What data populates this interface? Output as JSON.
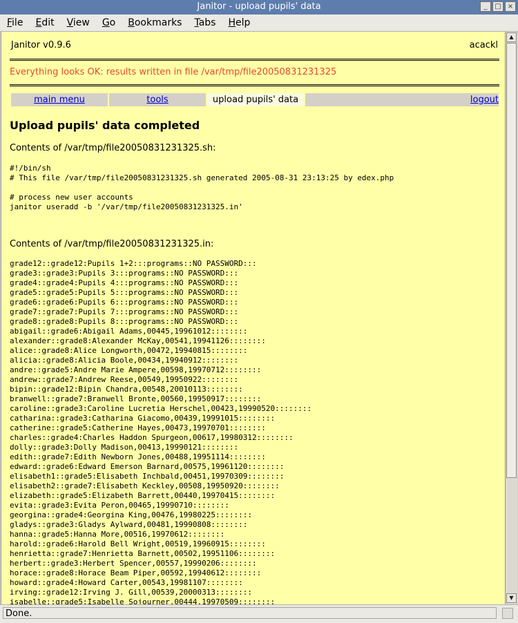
{
  "window": {
    "title": "Janitor - upload pupils' data",
    "btn_min": "_",
    "btn_max": "□",
    "btn_close": "×"
  },
  "menubar": [
    "File",
    "Edit",
    "View",
    "Go",
    "Bookmarks",
    "Tabs",
    "Help"
  ],
  "page": {
    "version": "Janitor v0.9.6",
    "user": "acackl",
    "message": "Everything looks OK: results written in file /var/tmp/file20050831231325",
    "nav": {
      "main_menu": "main menu",
      "tools": "tools",
      "current": "upload pupils' data",
      "logout": "logout"
    },
    "heading": "Upload pupils' data completed",
    "sh_label": "Contents of /var/tmp/file20050831231325.sh:",
    "sh_content": "#!/bin/sh\n# This file /var/tmp/file20050831231325.sh generated 2005-08-31 23:13:25 by edex.php\n\n# process new user accounts\njanitor useradd -b '/var/tmp/file20050831231325.in'",
    "in_label": "Contents of /var/tmp/file20050831231325.in:",
    "in_content": "grade12::grade12:Pupils 1+2:::programs::NO PASSWORD:::\ngrade3::grade3:Pupils 3:::programs::NO PASSWORD:::\ngrade4::grade4:Pupils 4:::programs::NO PASSWORD:::\ngrade5::grade5:Pupils 5:::programs::NO PASSWORD:::\ngrade6::grade6:Pupils 6:::programs::NO PASSWORD:::\ngrade7::grade7:Pupils 7:::programs::NO PASSWORD:::\ngrade8::grade8:Pupils 8:::programs::NO PASSWORD:::\nabigail::grade6:Abigail Adams,00445,19961012::::::::\nalexander::grade8:Alexander McKay,00541,19941126::::::::\nalice::grade8:Alice Longworth,00472,19940815::::::::\nalicia::grade8:Alicia Boole,00434,19940912::::::::\nandre::grade5:Andre Marie Ampere,00598,19970712::::::::\nandrew::grade7:Andrew Reese,00549,19950922::::::::\nbipin::grade12:Bipin Chandra,00548,20010113::::::::\nbranwell::grade7:Branwell Bronte,00560,19950917::::::::\ncaroline::grade3:Caroline Lucretia Herschel,00423,19990520::::::::\ncatharina::grade3:Catharina Giacomo,00439,19991015::::::::\ncatherine::grade5:Catherine Hayes,00473,19970701::::::::\ncharles::grade4:Charles Haddon Spurgeon,00617,19980312::::::::\ndolly::grade3:Dolly Madison,00413,19990121::::::::\nedith::grade7:Edith Newborn Jones,00488,19951114::::::::\nedward::grade6:Edward Emerson Barnard,00575,19961120::::::::\nelisabeth1::grade5:Elisabeth Inchbald,00451,19970309::::::::\nelisabeth2::grade7:Elisabeth Keckley,00508,19950920::::::::\nelizabeth::grade5:Elizabeth Barrett,00440,19970415::::::::\nevita::grade3:Evita Peron,00465,19990710::::::::\ngeorgina::grade4:Georgina King,00476,19980225::::::::\ngladys::grade3:Gladys Aylward,00481,19990808::::::::\nhanna::grade5:Hanna More,00516,19970612::::::::\nharold::grade6:Harold Bell Wright,00519,19960915::::::::\nhenrietta::grade7:Henrietta Barnett,00502,19951106::::::::\nherbert::grade3:Herbert Spencer,00557,19990206::::::::\nhorace::grade8:Horace Beam Piper,00592,19940612::::::::\nhoward::grade4:Howard Carter,00543,19981107::::::::\nirving::grade12:Irving J. Gill,00539,20000313::::::::\nisabelle::grade5:Isabelle Sojourner,00444,19970509::::::::"
  },
  "status": {
    "text": "Done."
  }
}
